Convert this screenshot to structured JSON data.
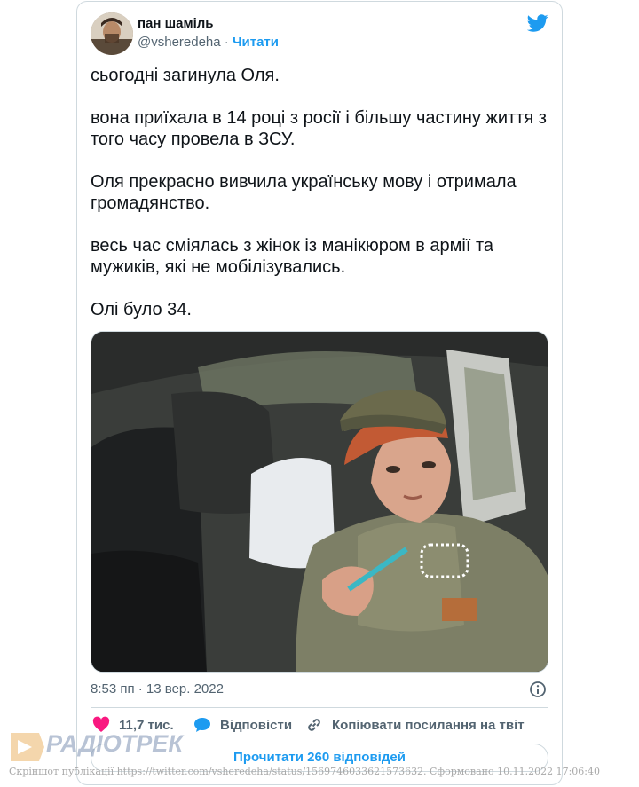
{
  "tweet": {
    "author_name": "пан шаміль",
    "handle": "@vsheredeha",
    "separator": "·",
    "follow_label": "Читати",
    "text": "сьогодні загинула Оля.\n\nвона приїхала в 14 році з росії і більшу частину життя з того часу провела в ЗСУ.\n\nОля прекрасно вивчила українську мову і отримала громадянство.\n\nвесь час сміялась з жінок із манікюром в армії та мужиків, які не мобілізувались.\n\nОлі було 34.",
    "timestamp": "8:53 пп · 13 вер. 2022",
    "likes": "11,7 тис.",
    "reply_label": "Відповісти",
    "copy_link_label": "Копіювати посилання на твіт",
    "read_replies_label": "Прочитати 260 відповідей"
  },
  "icons": {
    "brand": "twitter-bird-icon",
    "like": "heart-icon",
    "reply": "speech-bubble-icon",
    "copy": "link-icon",
    "info": "info-icon"
  },
  "colors": {
    "accent": "#1d9bf0",
    "like": "#f91880",
    "secondary_text": "#536471",
    "border": "#cfd9de"
  },
  "watermark": {
    "logo_text": "РАДІОТРЕК",
    "caption": "Скріншот публікації https://twitter.com/vsheredeha/status/1569746033621573632. Сформовано 10.11.2022 17:06:40"
  }
}
